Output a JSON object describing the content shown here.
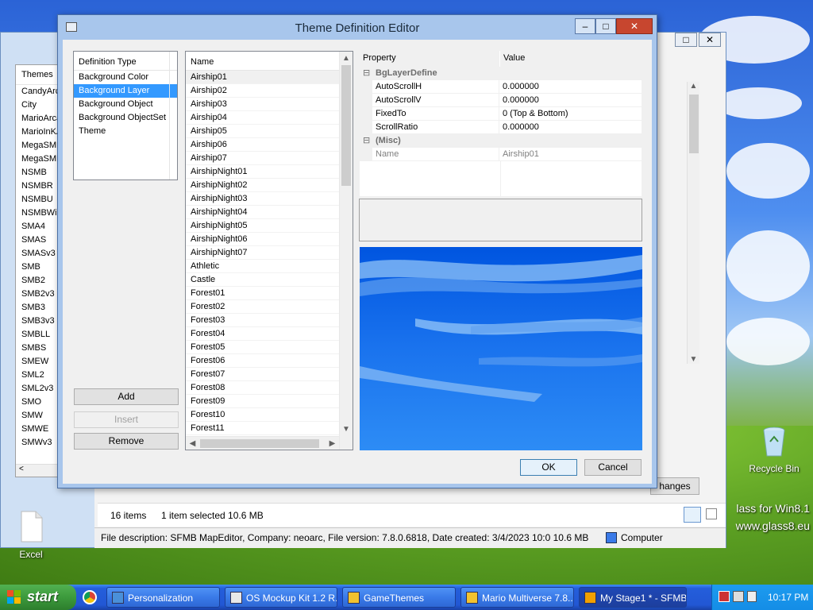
{
  "desktop": {
    "excel_label": "Excel",
    "recycle_label": "Recycle Bin",
    "watermark_line1": "lass for Win8.1",
    "watermark_line2": "www.glass8.eu"
  },
  "background_window": {
    "themes_header": "Themes",
    "themes": [
      "CandyArc",
      "City",
      "MarioArca",
      "MarioInKA",
      "MegaSMM",
      "MegaSMM",
      "NSMB",
      "NSMBR",
      "NSMBU",
      "NSMBWii",
      "SMA4",
      "SMAS",
      "SMASv3",
      "SMB",
      "SMB2",
      "SMB2v3",
      "SMB3",
      "SMB3v3",
      "SMBLL",
      "SMBS",
      "SMEW",
      "SML2",
      "SML2v3",
      "SMO",
      "SMW",
      "SMWE",
      "SMWv3"
    ],
    "changes_label": "hanges",
    "items_count": "16 items",
    "selection_info": "1 item selected  10.6 MB",
    "file_description": "File description: SFMB MapEditor, Company: neoarc, File version: 7.8.0.6818, Date created: 3/4/2023 10:0 10.6 MB",
    "location": "Computer"
  },
  "dialog": {
    "title": "Theme Definition Editor",
    "min_glyph": "–",
    "max_glyph": "□",
    "close_glyph": "✕",
    "def_type_header": "Definition Type",
    "def_types": [
      "Background Color",
      "Background Layer",
      "Background Object",
      "Background ObjectSet",
      "Theme"
    ],
    "selected_def_type": 1,
    "name_header": "Name",
    "names": [
      "Airship01",
      "Airship02",
      "Airship03",
      "Airship04",
      "Airship05",
      "Airship06",
      "Airship07",
      "AirshipNight01",
      "AirshipNight02",
      "AirshipNight03",
      "AirshipNight04",
      "AirshipNight05",
      "AirshipNight06",
      "AirshipNight07",
      "Athletic",
      "Castle",
      "Forest01",
      "Forest02",
      "Forest03",
      "Forest04",
      "Forest05",
      "Forest06",
      "Forest07",
      "Forest08",
      "Forest09",
      "Forest10",
      "Forest11"
    ],
    "add_label": "Add",
    "insert_label": "Insert",
    "remove_label": "Remove",
    "prop_header": "Property",
    "value_header": "Value",
    "category1": "BgLayerDefine",
    "category2": "(Misc)",
    "collapse_glyph": "⊟",
    "props": [
      {
        "key": "AutoScrollH",
        "value": "0.000000"
      },
      {
        "key": "AutoScrollV",
        "value": "0.000000"
      },
      {
        "key": "FixedTo",
        "value": "0 (Top & Bottom)"
      },
      {
        "key": "ScrollRatio",
        "value": "0.000000"
      }
    ],
    "misc_props": [
      {
        "key": "Name",
        "value": "Airship01"
      }
    ],
    "ok_label": "OK",
    "cancel_label": "Cancel"
  },
  "taskbar": {
    "start_label": "start",
    "tasks": [
      "Personalization",
      "OS Mockup Kit 1.2 R...",
      "GameThemes",
      "Mario Multiverse 7.8...",
      "My Stage1 * - SFMB..."
    ],
    "clock": "10:17 PM"
  }
}
